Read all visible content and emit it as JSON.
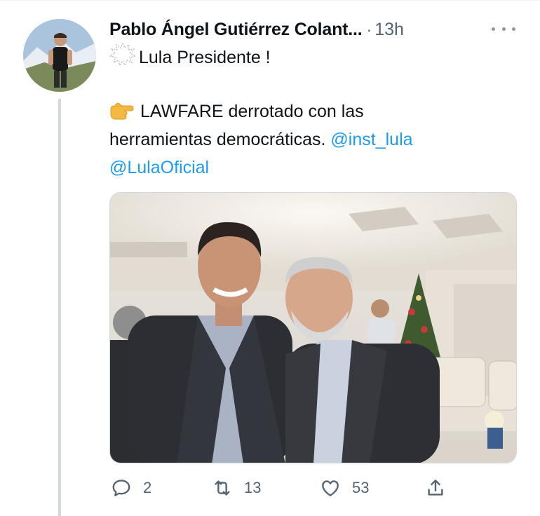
{
  "tweet": {
    "author_name": "Pablo Ángel Gutiérrez Colant...",
    "separator": "·",
    "time": "13h",
    "line1_text": "Lula Presidente !",
    "line2_text": "LAWFARE derrotado con  las",
    "line3_text": "herramientas democráticas.",
    "mention1": "@inst_lula",
    "mention2": "@LulaOficial",
    "line1_emoji": "collision-outline-icon",
    "line2_emoji": "pointing-hand-icon"
  },
  "actions": {
    "reply_count": "2",
    "retweet_count": "13",
    "like_count": "53"
  },
  "colors": {
    "link": "#1d9bf0",
    "secondary_text": "#536471",
    "thread_line": "#cfd9de"
  }
}
